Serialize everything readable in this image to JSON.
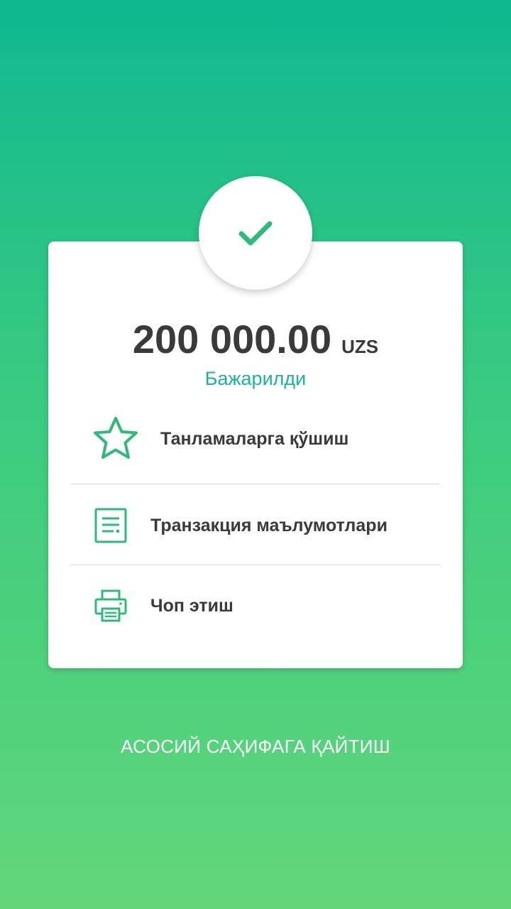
{
  "result": {
    "amount": "200 000.00",
    "currency": "UZS",
    "status": "Бажарилди"
  },
  "actions": [
    {
      "label": "Танламаларга қўшиш",
      "icon": "star-icon"
    },
    {
      "label": "Транзакция маълумотлари",
      "icon": "document-icon"
    },
    {
      "label": "Чоп этиш",
      "icon": "printer-icon"
    }
  ],
  "footer": {
    "home_label": "АСОСИЙ САҲИФАГА ҚАЙТИШ"
  },
  "colors": {
    "accent": "#2dbb7a",
    "status_text": "#1ab39b",
    "gradient_top": "#0fb890",
    "gradient_bottom": "#64d67a"
  }
}
